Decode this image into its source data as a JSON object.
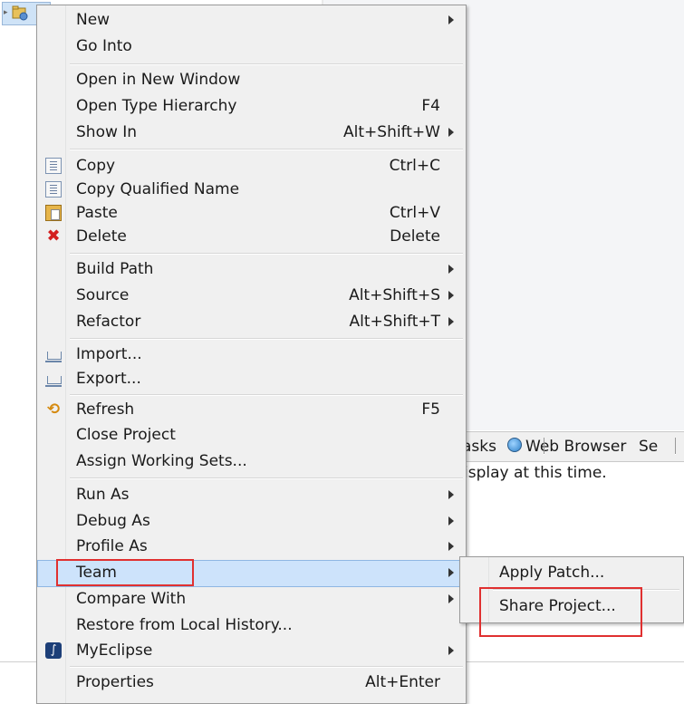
{
  "menu": {
    "items": [
      {
        "label": "New",
        "accel": "",
        "submenu": true
      },
      {
        "label": "Go Into",
        "accel": "",
        "submenu": false
      },
      {
        "label": "Open in New Window",
        "accel": "",
        "submenu": false
      },
      {
        "label": "Open Type Hierarchy",
        "accel": "F4",
        "submenu": false
      },
      {
        "label": "Show In",
        "accel": "Alt+Shift+W",
        "submenu": true
      },
      {
        "label": "Copy",
        "accel": "Ctrl+C",
        "submenu": false,
        "icon": "copy-icon"
      },
      {
        "label": "Copy Qualified Name",
        "accel": "",
        "submenu": false,
        "icon": "copy-qualified-icon"
      },
      {
        "label": "Paste",
        "accel": "Ctrl+V",
        "submenu": false,
        "icon": "paste-icon"
      },
      {
        "label": "Delete",
        "accel": "Delete",
        "submenu": false,
        "icon": "delete-icon"
      },
      {
        "label": "Build Path",
        "accel": "",
        "submenu": true
      },
      {
        "label": "Source",
        "accel": "Alt+Shift+S",
        "submenu": true
      },
      {
        "label": "Refactor",
        "accel": "Alt+Shift+T",
        "submenu": true
      },
      {
        "label": "Import...",
        "accel": "",
        "submenu": false,
        "icon": "import-icon"
      },
      {
        "label": "Export...",
        "accel": "",
        "submenu": false,
        "icon": "export-icon"
      },
      {
        "label": "Refresh",
        "accel": "F5",
        "submenu": false,
        "icon": "refresh-icon"
      },
      {
        "label": "Close Project",
        "accel": "",
        "submenu": false
      },
      {
        "label": "Assign Working Sets...",
        "accel": "",
        "submenu": false
      },
      {
        "label": "Run As",
        "accel": "",
        "submenu": true
      },
      {
        "label": "Debug As",
        "accel": "",
        "submenu": true
      },
      {
        "label": "Profile As",
        "accel": "",
        "submenu": true
      },
      {
        "label": "Team",
        "accel": "",
        "submenu": true,
        "highlighted": true
      },
      {
        "label": "Compare With",
        "accel": "",
        "submenu": true
      },
      {
        "label": "Restore from Local History...",
        "accel": "",
        "submenu": false
      },
      {
        "label": "MyEclipse",
        "accel": "",
        "submenu": true,
        "icon": "myeclipse-icon"
      },
      {
        "label": "Properties",
        "accel": "Alt+Enter",
        "submenu": false
      }
    ]
  },
  "team_submenu": {
    "items": [
      {
        "label": "Apply Patch..."
      },
      {
        "label": "Share Project..."
      }
    ]
  },
  "background": {
    "tab_tasks": "asks",
    "tab_web_browser": "Web Browser",
    "tab_se": "Se",
    "message": "isplay at this time."
  },
  "colors": {
    "menu_bg": "#f0f0f0",
    "highlight_bg": "#cde3fb",
    "highlight_border": "#8fb7e3",
    "annotation_red": "#e03030"
  }
}
